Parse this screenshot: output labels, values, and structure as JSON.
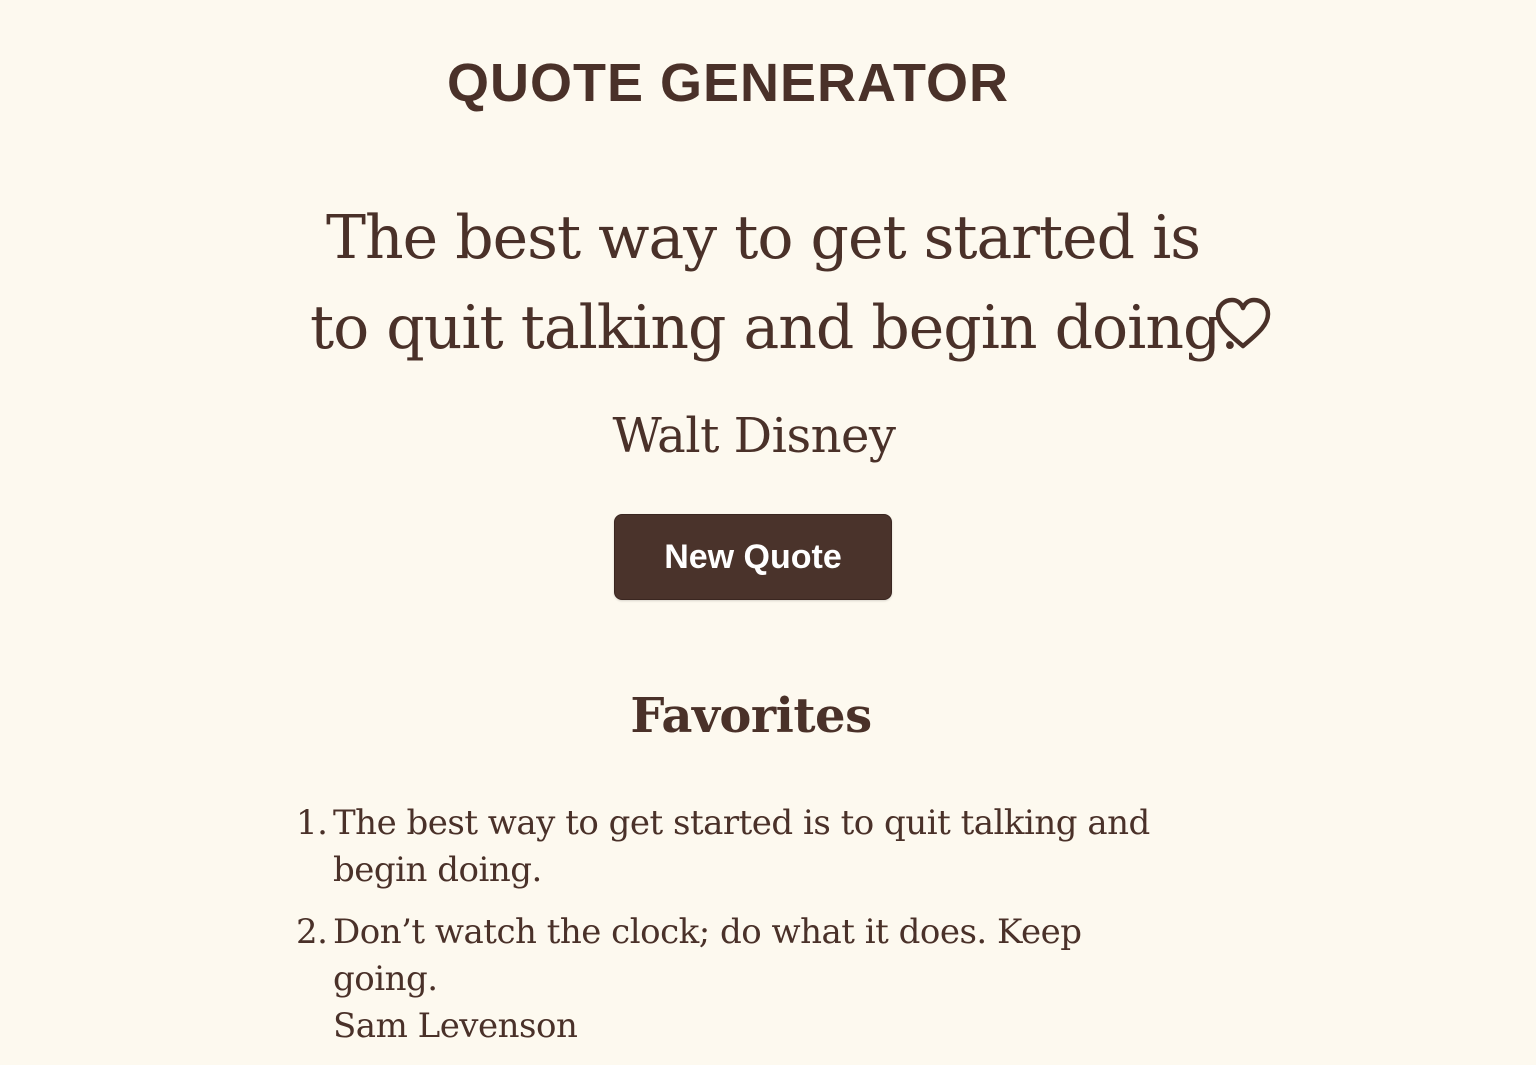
{
  "app": {
    "title": "QUOTE GENERATOR"
  },
  "current_quote": {
    "line1": "The best way to get started is",
    "line2": "to quit talking and begin doing.",
    "author": "Walt Disney",
    "favorite_icon": "heart-outline-icon"
  },
  "actions": {
    "new_quote_label": "New Quote"
  },
  "favorites": {
    "title": "Favorites",
    "items": [
      {
        "number": "1.",
        "text": "The best way to get started is to quit talking and begin doing.",
        "author": ""
      },
      {
        "number": "2.",
        "text": "Don’t watch the clock; do what it does. Keep going.",
        "author": "Sam Levenson"
      }
    ]
  },
  "colors": {
    "background": "#fdf9ef",
    "text": "#4a3129",
    "button": "#4a332b",
    "button_text": "#ffffff"
  }
}
